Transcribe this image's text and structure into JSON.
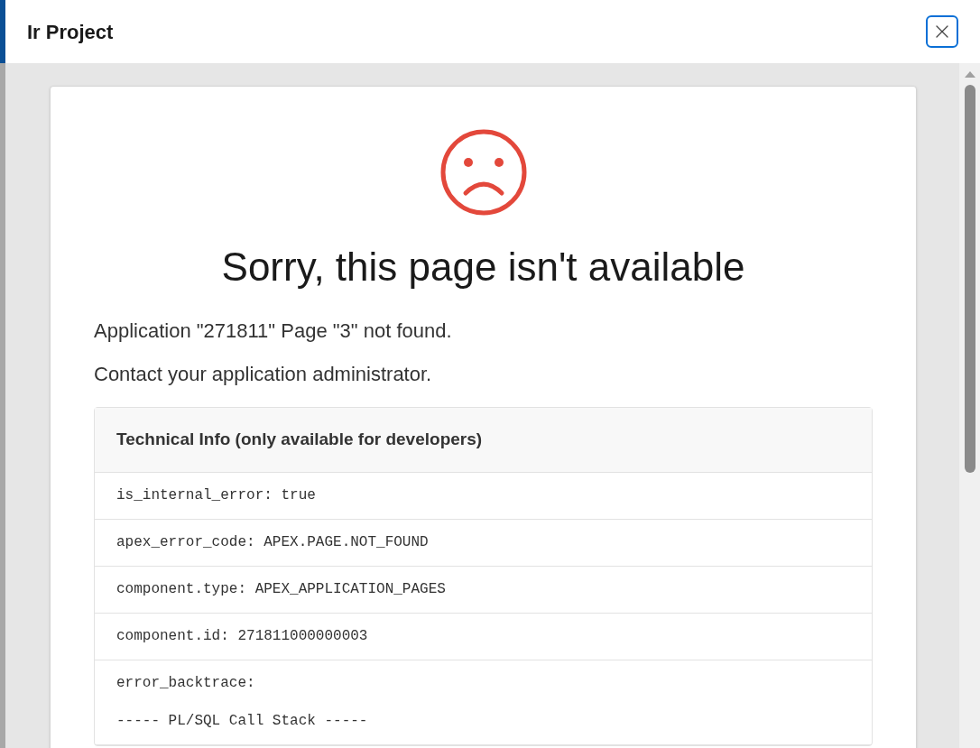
{
  "dialog": {
    "title": "Ir Project"
  },
  "error": {
    "heading": "Sorry, this page isn't available",
    "messages": [
      "Application \"271811\" Page \"3\" not found.",
      "Contact your application administrator."
    ]
  },
  "technical_info": {
    "title": "Technical Info (only available for developers)",
    "rows": [
      "is_internal_error: true",
      "apex_error_code: APEX.PAGE.NOT_FOUND",
      "component.type: APEX_APPLICATION_PAGES",
      "component.id: 271811000000003",
      "error_backtrace:\n\n----- PL/SQL Call Stack -----"
    ]
  }
}
